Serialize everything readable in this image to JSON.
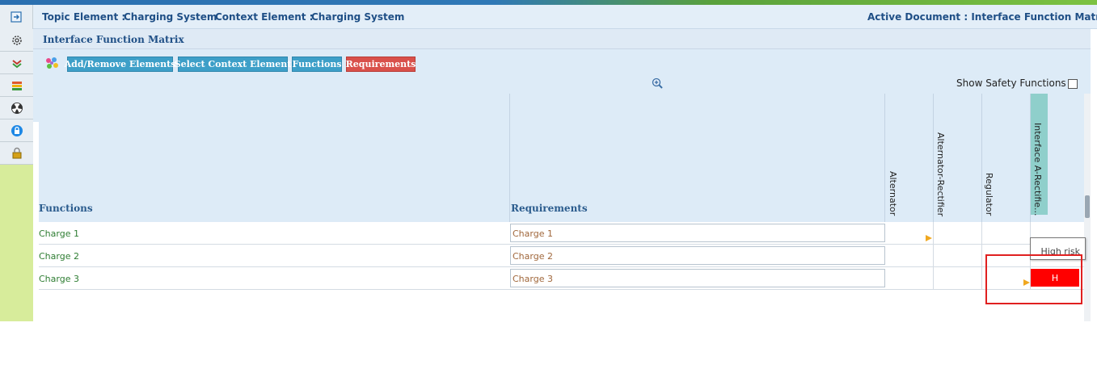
{
  "header": {
    "topic_label": "Topic Element :",
    "topic_value": "Charging System",
    "context_label": "Context Element :",
    "context_value": "Charging System",
    "active_doc": "Active Document : Interface Function Matrix"
  },
  "sidebar": {
    "items": [
      {
        "icon": "gear-icon"
      },
      {
        "icon": "layers-icon"
      },
      {
        "icon": "stack-icon"
      },
      {
        "icon": "radiation-icon"
      },
      {
        "icon": "lock-blue-icon"
      },
      {
        "icon": "padlock-icon"
      }
    ]
  },
  "panel": {
    "title": "Interface Function Matrix",
    "buttons": {
      "add_remove": "Add/Remove Elements",
      "select_context": "Select Context Element",
      "functions": "Functions",
      "requirements": "Requirements"
    },
    "show_safety": "Show Safety Functions"
  },
  "table": {
    "col_functions": "Functions",
    "col_requirements": "Requirements",
    "elements": [
      "Alternator",
      "Alternator-Rectifier",
      "Regulator",
      "Interface A-Rectifie..."
    ],
    "rows": [
      {
        "function": "Charge 1",
        "requirement": "Charge 1"
      },
      {
        "function": "Charge 2",
        "requirement": "Charge 2"
      },
      {
        "function": "Charge 3",
        "requirement": "Charge 3",
        "risk_cell": "H"
      }
    ],
    "tooltip": "High risk"
  },
  "colors": {
    "accent_blue": "#3d9fc8",
    "accent_red": "#d9504a",
    "risk_red": "#ff0000",
    "function_green": "#2e7d32",
    "requirement_brown": "#a0673b"
  }
}
